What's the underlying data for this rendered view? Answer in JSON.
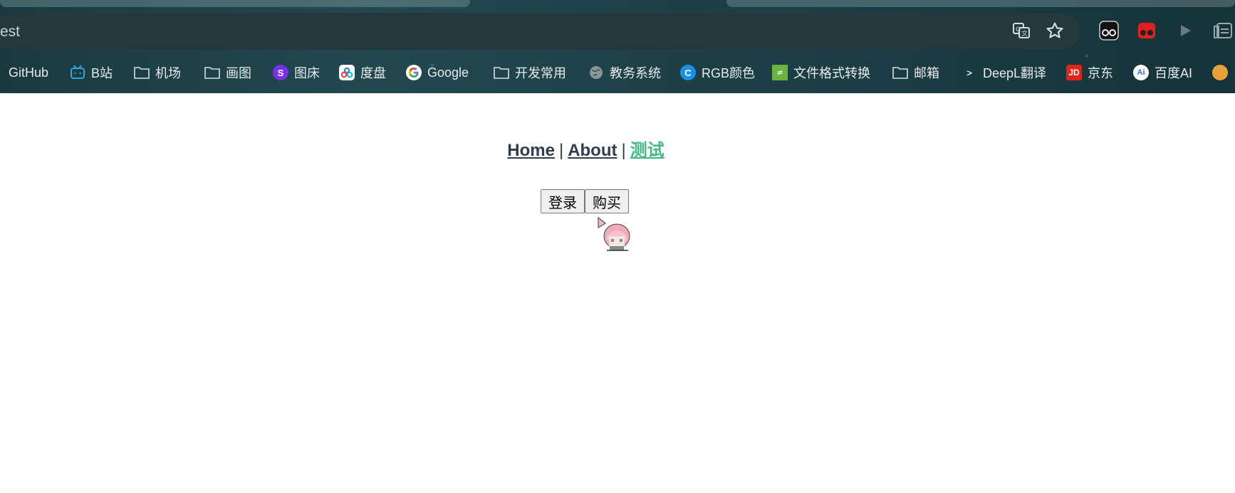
{
  "browser": {
    "url_fragment": "est",
    "toolbar_icons": [
      "translate-icon",
      "star-icon"
    ],
    "extension_icons": [
      "glasses-extension-icon",
      "red-extension-icon",
      "play-extension-icon",
      "reader-extension-icon"
    ]
  },
  "bookmarks": [
    {
      "label": "GitHub",
      "icon": "none"
    },
    {
      "label": "B站",
      "icon": "bilibili-icon"
    },
    {
      "label": "机场",
      "icon": "folder-icon"
    },
    {
      "label": "画图",
      "icon": "folder-icon"
    },
    {
      "label": "图床",
      "icon": "image-host-icon"
    },
    {
      "label": "度盘",
      "icon": "baidu-pan-icon"
    },
    {
      "label": "Google",
      "icon": "google-icon"
    },
    {
      "label": "开发常用",
      "icon": "folder-icon"
    },
    {
      "label": "教务系统",
      "icon": "globe-icon"
    },
    {
      "label": "RGB颜色",
      "icon": "color-icon"
    },
    {
      "label": "文件格式转换",
      "icon": "convert-icon"
    },
    {
      "label": "邮箱",
      "icon": "folder-icon"
    },
    {
      "label": "DeepL翻译",
      "icon": "deepl-icon"
    },
    {
      "label": "京东",
      "icon": "jd-icon"
    },
    {
      "label": "百度AI",
      "icon": "baidu-ai-icon"
    }
  ],
  "nav": {
    "links": [
      {
        "label": "Home",
        "active": false
      },
      {
        "label": "About",
        "active": false
      },
      {
        "label": "测试",
        "active": true
      }
    ],
    "separator": "|"
  },
  "buttons": {
    "login": "登录",
    "buy": "购买"
  },
  "colors": {
    "nav_text": "#2c3e50",
    "nav_active": "#42b983",
    "page_bg": "#ffffff"
  }
}
